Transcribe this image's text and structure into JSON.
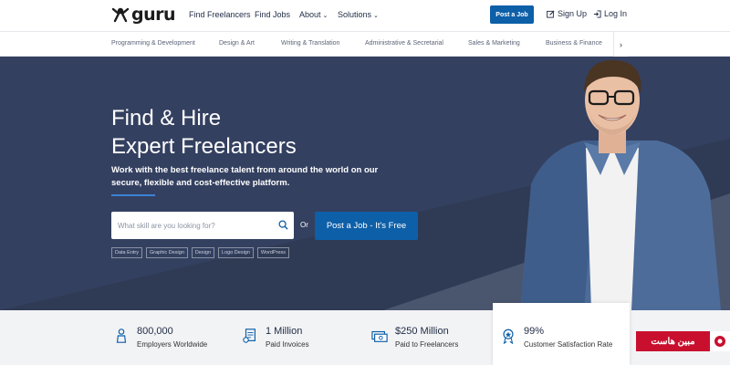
{
  "brand": {
    "logo_text": "guru"
  },
  "nav": {
    "find_freelancers": "Find Freelancers",
    "find_jobs": "Find Jobs",
    "about": "About",
    "solutions": "Solutions",
    "post_job": "Post a Job",
    "sign_up": "Sign Up",
    "log_in": "Log In"
  },
  "categories": {
    "c0": "Programming & Development",
    "c1": "Design & Art",
    "c2": "Writing & Translation",
    "c3": "Administrative & Secretarial",
    "c4": "Sales & Marketing",
    "c5": "Business & Finance"
  },
  "hero": {
    "title_line1": "Find & Hire",
    "title_line2": "Expert Freelancers",
    "subtitle": "Work with the best freelance talent from around the world on our secure, flexible and cost-effective platform.",
    "search_placeholder": "What skill are you looking for?",
    "or": "Or",
    "post_job_button": "Post a Job - It's Free",
    "tags": [
      "Data Entry",
      "Graphic Design",
      "Design",
      "Logo Design",
      "WordPress"
    ]
  },
  "stats": [
    {
      "number": "800,000",
      "label": "Employers Worldwide",
      "icon": "employer-icon"
    },
    {
      "number": "1 Million",
      "label": "Paid Invoices",
      "icon": "invoice-icon"
    },
    {
      "number": "$250 Million",
      "label": "Paid to Freelancers",
      "icon": "money-icon"
    },
    {
      "number": "99%",
      "label": "Customer Satisfaction Rate",
      "icon": "award-icon"
    }
  ],
  "watermark": {
    "text": "مبین هاست"
  },
  "colors": {
    "primary": "#0d5fa8",
    "hero_bg": "#2f3a54",
    "accent_rule": "#3b82d6"
  }
}
